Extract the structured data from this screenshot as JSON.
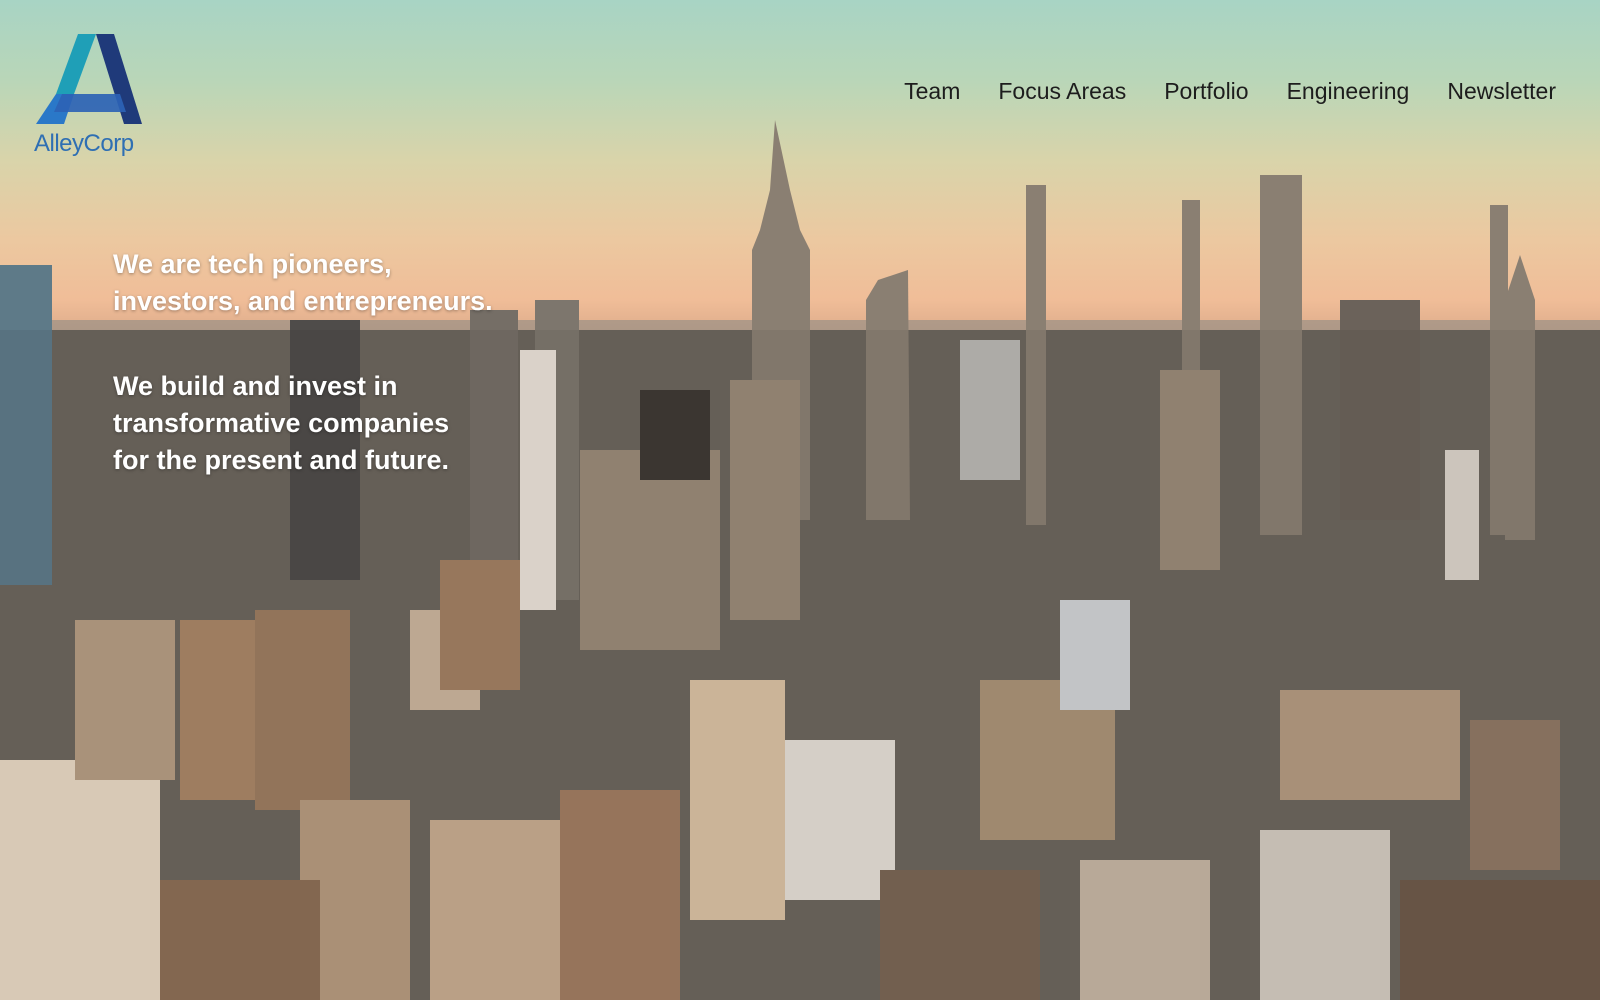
{
  "brand": {
    "name": "AlleyCorp",
    "colors": {
      "dark": "#1f3a7a",
      "teal": "#1d9bb5",
      "blue": "#2f6fb3"
    }
  },
  "nav": {
    "items": [
      {
        "label": "Team"
      },
      {
        "label": "Focus Areas"
      },
      {
        "label": "Portfolio"
      },
      {
        "label": "Engineering"
      },
      {
        "label": "Newsletter"
      }
    ]
  },
  "hero": {
    "background": "aerial-city-skyline-image",
    "paragraphs": [
      {
        "lines": [
          "We are tech pioneers,",
          "investors, and entrepreneurs."
        ]
      },
      {
        "lines": [
          "We build and invest in",
          "transformative companies",
          "for the present and future."
        ]
      }
    ]
  }
}
